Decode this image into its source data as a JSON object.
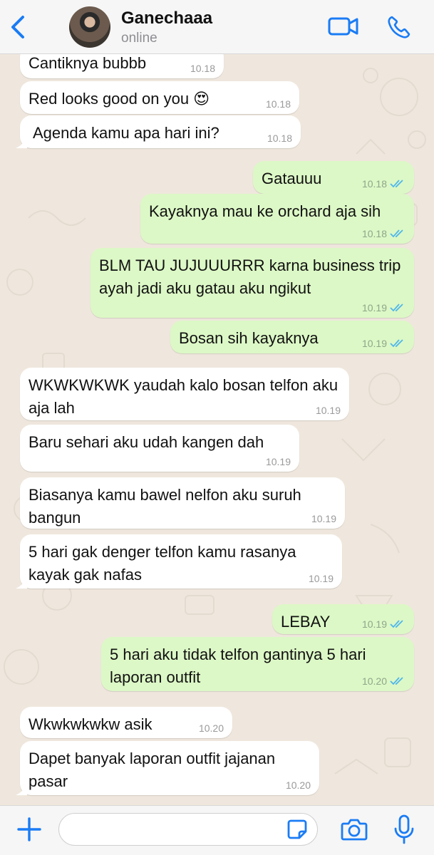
{
  "header": {
    "contact_name": "Ganechaaa",
    "status": "online",
    "accent_color": "#1a7cf5"
  },
  "messages": [
    {
      "dir": "in",
      "text": "Cantiknya bubbb",
      "time": "10.18"
    },
    {
      "dir": "in",
      "text": "Red looks good on you 😍",
      "time": "10.18"
    },
    {
      "dir": "in",
      "text": "Agenda kamu apa hari ini?",
      "time": "10.18"
    },
    {
      "dir": "out",
      "text": "Gatauuu",
      "time": "10.18",
      "read": true
    },
    {
      "dir": "out",
      "text": "Kayaknya mau ke orchard aja sih",
      "time": "10.18",
      "read": true
    },
    {
      "dir": "out",
      "text": "BLM TAU JUJUUURRR karna business trip ayah jadi aku gatau aku ngikut",
      "time": "10.19",
      "read": true
    },
    {
      "dir": "out",
      "text": "Bosan sih kayaknya",
      "time": "10.19",
      "read": true
    },
    {
      "dir": "in",
      "text": "WKWKWKWK yaudah kalo bosan telfon aku aja lah",
      "time": "10.19"
    },
    {
      "dir": "in",
      "text": "Baru sehari aku udah kangen dah",
      "time": "10.19"
    },
    {
      "dir": "in",
      "text": "Biasanya kamu bawel nelfon aku suruh bangun",
      "time": "10.19"
    },
    {
      "dir": "in",
      "text": "5 hari gak denger telfon kamu rasanya kayak gak nafas",
      "time": "10.19"
    },
    {
      "dir": "out",
      "text": "LEBAY",
      "time": "10.19",
      "read": true
    },
    {
      "dir": "out",
      "text": "5 hari aku tidak telfon gantinya 5 hari laporan outfit",
      "time": "10.20",
      "read": true
    },
    {
      "dir": "in",
      "text": "Wkwkwkwkw asik",
      "time": "10.20"
    },
    {
      "dir": "in",
      "text": "Dapet banyak laporan outfit jajanan pasar",
      "time": "10.20"
    }
  ],
  "composer": {
    "placeholder": "",
    "value": ""
  },
  "colors": {
    "incoming_bubble": "#ffffff",
    "outgoing_bubble": "#dcf8c6",
    "read_ticks": "#4fb6ec",
    "chat_background": "#efe7dd"
  }
}
